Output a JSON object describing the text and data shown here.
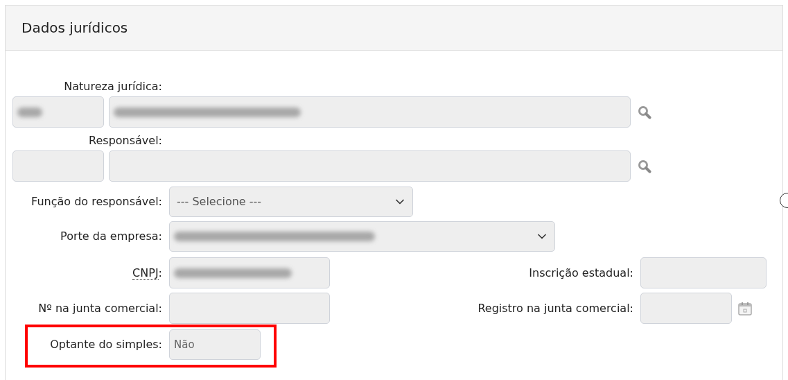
{
  "panel": {
    "title": "Dados jurídicos"
  },
  "lookups": [
    {
      "label": "Natureza jurídica:",
      "code_blurred": true,
      "description_blurred": true
    },
    {
      "label": "Responsável:",
      "code_blurred": false,
      "description_blurred": false
    }
  ],
  "selects": [
    {
      "label": "Função do responsável:",
      "placeholder": "--- Selecione ---",
      "blurred": false
    },
    {
      "label": "Porte da empresa:",
      "blurred": true
    }
  ],
  "cnpj": {
    "label": "CNPJ",
    "label_suffix": ":",
    "blurred": true
  },
  "inscricao_estadual": {
    "label": "Inscrição estadual:"
  },
  "junta_numero": {
    "label": "Nº na junta comercial:"
  },
  "junta_registro": {
    "label": "Registro na junta comercial:"
  },
  "optante_simples": {
    "label": "Optante do simples:",
    "value": "Não",
    "highlighted": true
  }
}
